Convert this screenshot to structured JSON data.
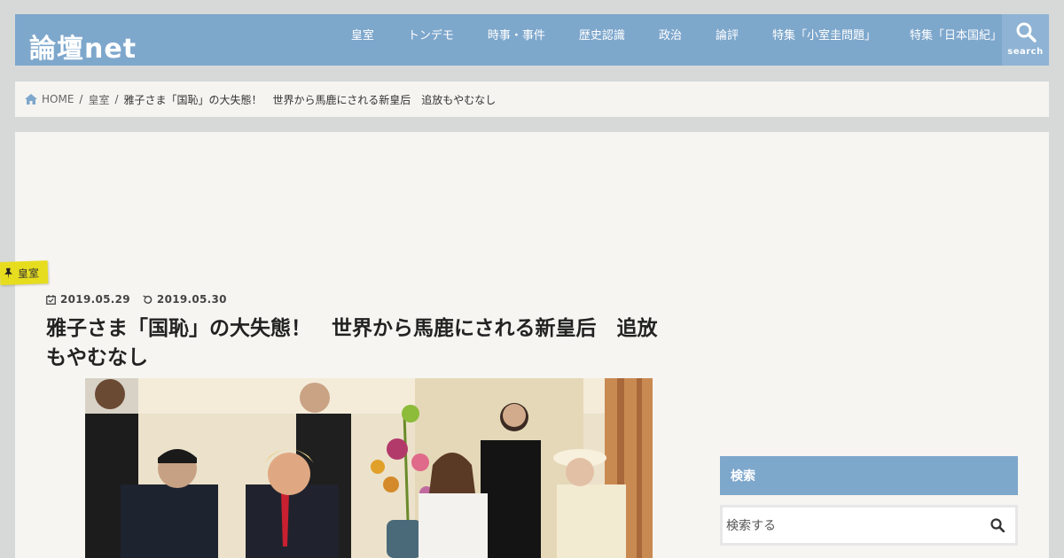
{
  "header": {
    "logo": "論壇net",
    "nav": [
      "皇室",
      "トンデモ",
      "時事・事件",
      "歴史認識",
      "政治",
      "論評",
      "特集「小室圭問題」",
      "特集「日本国紀」"
    ],
    "search_label": "search"
  },
  "breadcrumb": {
    "home": "HOME",
    "category": "皇室",
    "current": "雅子さま「国恥」の大失態！　世界から馬鹿にされる新皇后　追放もやむなし"
  },
  "article": {
    "category_tag": "皇室",
    "published": "2019.05.29",
    "updated": "2019.05.30",
    "title": "雅子さま「国恥」の大失態！　世界から馬鹿にされる新皇后　追放もやむなし"
  },
  "sidebar": {
    "search_heading": "検索",
    "search_placeholder": "検索する"
  },
  "colors": {
    "accent": "#7ea7cc",
    "tag": "#e7dd1f",
    "background": "#d6d9d8",
    "card": "#f6f5f1"
  }
}
